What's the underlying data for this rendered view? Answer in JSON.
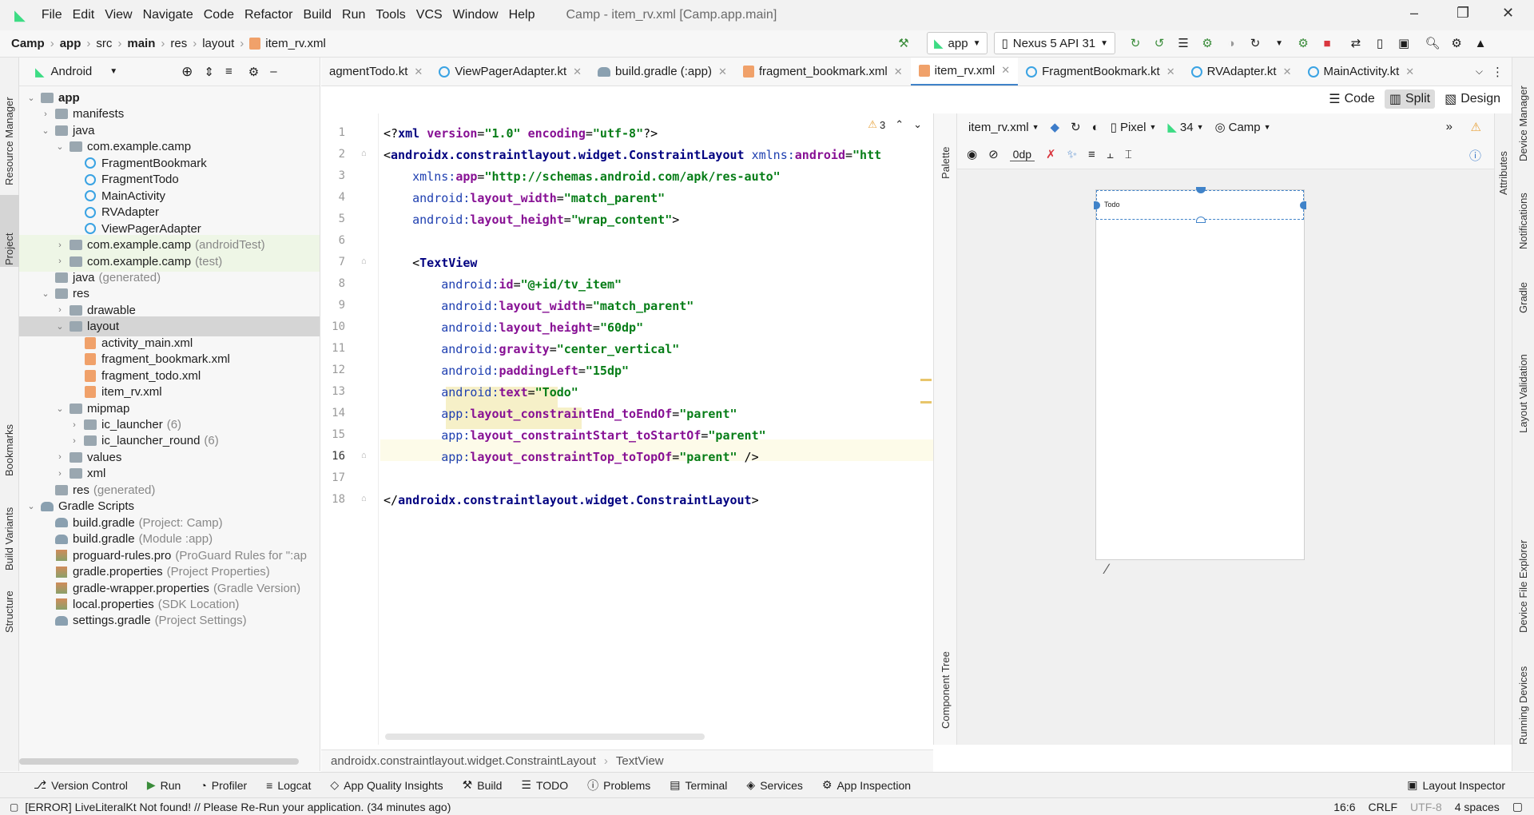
{
  "menu": {
    "items": [
      "File",
      "Edit",
      "View",
      "Navigate",
      "Code",
      "Refactor",
      "Build",
      "Run",
      "Tools",
      "VCS",
      "Window",
      "Help"
    ],
    "window_title": "Camp - item_rv.xml [Camp.app.main]"
  },
  "breadcrumb": [
    "Camp",
    "app",
    "src",
    "main",
    "res",
    "layout",
    "item_rv.xml"
  ],
  "run_config": {
    "module": "app",
    "device": "Nexus 5 API 31"
  },
  "project_panel": {
    "view_label": "Android",
    "tree": [
      {
        "label": "app",
        "extra": "",
        "level": 0,
        "arrow": "down",
        "icon": "folder",
        "bold": true
      },
      {
        "label": "manifests",
        "extra": "",
        "level": 1,
        "arrow": "right",
        "icon": "folder"
      },
      {
        "label": "java",
        "extra": "",
        "level": 1,
        "arrow": "down",
        "icon": "folder"
      },
      {
        "label": "com.example.camp",
        "extra": "",
        "level": 2,
        "arrow": "down",
        "icon": "folder"
      },
      {
        "label": "FragmentBookmark",
        "extra": "",
        "level": 3,
        "arrow": "",
        "icon": "kt"
      },
      {
        "label": "FragmentTodo",
        "extra": "",
        "level": 3,
        "arrow": "",
        "icon": "kt"
      },
      {
        "label": "MainActivity",
        "extra": "",
        "level": 3,
        "arrow": "",
        "icon": "kt"
      },
      {
        "label": "RVAdapter",
        "extra": "",
        "level": 3,
        "arrow": "",
        "icon": "kt"
      },
      {
        "label": "ViewPagerAdapter",
        "extra": "",
        "level": 3,
        "arrow": "",
        "icon": "kt"
      },
      {
        "label": "com.example.camp",
        "extra": "(androidTest)",
        "level": 2,
        "arrow": "right",
        "icon": "folder",
        "highlight": true
      },
      {
        "label": "com.example.camp",
        "extra": "(test)",
        "level": 2,
        "arrow": "right",
        "icon": "folder",
        "highlight": true
      },
      {
        "label": "java",
        "extra": "(generated)",
        "level": 1,
        "arrow": "",
        "icon": "folder"
      },
      {
        "label": "res",
        "extra": "",
        "level": 1,
        "arrow": "down",
        "icon": "folder"
      },
      {
        "label": "drawable",
        "extra": "",
        "level": 2,
        "arrow": "right",
        "icon": "folder"
      },
      {
        "label": "layout",
        "extra": "",
        "level": 2,
        "arrow": "down",
        "icon": "folder",
        "selected": true
      },
      {
        "label": "activity_main.xml",
        "extra": "",
        "level": 3,
        "arrow": "",
        "icon": "xml"
      },
      {
        "label": "fragment_bookmark.xml",
        "extra": "",
        "level": 3,
        "arrow": "",
        "icon": "xml"
      },
      {
        "label": "fragment_todo.xml",
        "extra": "",
        "level": 3,
        "arrow": "",
        "icon": "xml"
      },
      {
        "label": "item_rv.xml",
        "extra": "",
        "level": 3,
        "arrow": "",
        "icon": "xml"
      },
      {
        "label": "mipmap",
        "extra": "",
        "level": 2,
        "arrow": "down",
        "icon": "folder"
      },
      {
        "label": "ic_launcher",
        "extra": "(6)",
        "level": 3,
        "arrow": "right",
        "icon": "folder"
      },
      {
        "label": "ic_launcher_round",
        "extra": "(6)",
        "level": 3,
        "arrow": "right",
        "icon": "folder"
      },
      {
        "label": "values",
        "extra": "",
        "level": 2,
        "arrow": "right",
        "icon": "folder"
      },
      {
        "label": "xml",
        "extra": "",
        "level": 2,
        "arrow": "right",
        "icon": "folder"
      },
      {
        "label": "res",
        "extra": "(generated)",
        "level": 1,
        "arrow": "",
        "icon": "folder"
      },
      {
        "label": "Gradle Scripts",
        "extra": "",
        "level": 0,
        "arrow": "down",
        "icon": "gradle"
      },
      {
        "label": "build.gradle",
        "extra": "(Project: Camp)",
        "level": 1,
        "arrow": "",
        "icon": "gradle"
      },
      {
        "label": "build.gradle",
        "extra": "(Module :app)",
        "level": 1,
        "arrow": "",
        "icon": "gradle"
      },
      {
        "label": "proguard-rules.pro",
        "extra": "(ProGuard Rules for \":ap",
        "level": 1,
        "arrow": "",
        "icon": "prop"
      },
      {
        "label": "gradle.properties",
        "extra": "(Project Properties)",
        "level": 1,
        "arrow": "",
        "icon": "prop"
      },
      {
        "label": "gradle-wrapper.properties",
        "extra": "(Gradle Version)",
        "level": 1,
        "arrow": "",
        "icon": "prop"
      },
      {
        "label": "local.properties",
        "extra": "(SDK Location)",
        "level": 1,
        "arrow": "",
        "icon": "prop"
      },
      {
        "label": "settings.gradle",
        "extra": "(Project Settings)",
        "level": 1,
        "arrow": "",
        "icon": "gradle"
      }
    ]
  },
  "left_strip": [
    "Resource Manager",
    "Project",
    "Bookmarks",
    "Build Variants",
    "Structure"
  ],
  "tabs": [
    {
      "label": "agmentTodo.kt",
      "icon": "kt"
    },
    {
      "label": "ViewPagerAdapter.kt",
      "icon": "kt"
    },
    {
      "label": "build.gradle (:app)",
      "icon": "gradle"
    },
    {
      "label": "fragment_bookmark.xml",
      "icon": "xml"
    },
    {
      "label": "item_rv.xml",
      "icon": "xml",
      "active": true
    },
    {
      "label": "FragmentBookmark.kt",
      "icon": "kt"
    },
    {
      "label": "RVAdapter.kt",
      "icon": "kt"
    },
    {
      "label": "MainActivity.kt",
      "icon": "kt"
    }
  ],
  "view_modes": [
    "Code",
    "Split",
    "Design"
  ],
  "editor": {
    "warnings_count": "3",
    "lines": [
      [
        [
          "t-plain",
          "<?"
        ],
        [
          "t-tag",
          "xml "
        ],
        [
          "t-attr",
          "version"
        ],
        [
          "t-plain",
          "="
        ],
        [
          "t-val",
          "\"1.0\" "
        ],
        [
          "t-attr",
          "encoding"
        ],
        [
          "t-plain",
          "="
        ],
        [
          "t-val",
          "\"utf-8\""
        ],
        [
          "t-plain",
          "?>"
        ]
      ],
      [
        [
          "t-plain",
          "<"
        ],
        [
          "t-tag",
          "androidx.constraintlayout.widget.ConstraintLayout "
        ],
        [
          "t-ns",
          "xmlns:"
        ],
        [
          "t-attr",
          "android"
        ],
        [
          "t-plain",
          "="
        ],
        [
          "t-val",
          "\"htt"
        ]
      ],
      [
        [
          "t-plain",
          "    "
        ],
        [
          "t-ns",
          "xmlns:"
        ],
        [
          "t-attr",
          "app"
        ],
        [
          "t-plain",
          "="
        ],
        [
          "t-val",
          "\"http://schemas.android.com/apk/res-auto\""
        ]
      ],
      [
        [
          "t-plain",
          "    "
        ],
        [
          "t-ns",
          "android:"
        ],
        [
          "t-attr",
          "layout_width"
        ],
        [
          "t-plain",
          "="
        ],
        [
          "t-val",
          "\"match_parent\""
        ]
      ],
      [
        [
          "t-plain",
          "    "
        ],
        [
          "t-ns",
          "android:"
        ],
        [
          "t-attr",
          "layout_height"
        ],
        [
          "t-plain",
          "="
        ],
        [
          "t-val",
          "\"wrap_content\""
        ],
        [
          "t-plain",
          ">"
        ]
      ],
      [],
      [
        [
          "t-plain",
          "    <"
        ],
        [
          "t-tag",
          "TextView"
        ]
      ],
      [
        [
          "t-plain",
          "        "
        ],
        [
          "t-ns",
          "android:"
        ],
        [
          "t-attr",
          "id"
        ],
        [
          "t-plain",
          "="
        ],
        [
          "t-val",
          "\"@+id/tv_item\""
        ]
      ],
      [
        [
          "t-plain",
          "        "
        ],
        [
          "t-ns",
          "android:"
        ],
        [
          "t-attr",
          "layout_width"
        ],
        [
          "t-plain",
          "="
        ],
        [
          "t-val",
          "\"match_parent\""
        ]
      ],
      [
        [
          "t-plain",
          "        "
        ],
        [
          "t-ns",
          "android:"
        ],
        [
          "t-attr",
          "layout_height"
        ],
        [
          "t-plain",
          "="
        ],
        [
          "t-val",
          "\"60dp\""
        ]
      ],
      [
        [
          "t-plain",
          "        "
        ],
        [
          "t-ns",
          "android:"
        ],
        [
          "t-attr",
          "gravity"
        ],
        [
          "t-plain",
          "="
        ],
        [
          "t-val",
          "\"center_vertical\""
        ]
      ],
      [
        [
          "t-plain",
          "        "
        ],
        [
          "t-ns",
          "android:"
        ],
        [
          "t-attr",
          "paddingLeft"
        ],
        [
          "t-plain",
          "="
        ],
        [
          "t-val",
          "\"15dp\""
        ]
      ],
      [
        [
          "t-plain",
          "        "
        ],
        [
          "t-ns",
          "android:"
        ],
        [
          "t-attr",
          "text"
        ],
        [
          "t-plain",
          "="
        ],
        [
          "t-val",
          "\"Todo\""
        ]
      ],
      [
        [
          "t-plain",
          "        "
        ],
        [
          "t-ns",
          "app:"
        ],
        [
          "t-attr",
          "layout_constraintEnd_toEndOf"
        ],
        [
          "t-plain",
          "="
        ],
        [
          "t-val",
          "\"parent\""
        ]
      ],
      [
        [
          "t-plain",
          "        "
        ],
        [
          "t-ns",
          "app:"
        ],
        [
          "t-attr",
          "layout_constraintStart_toStartOf"
        ],
        [
          "t-plain",
          "="
        ],
        [
          "t-val",
          "\"parent\""
        ]
      ],
      [
        [
          "t-plain",
          "        "
        ],
        [
          "t-ns",
          "app:"
        ],
        [
          "t-attr",
          "layout_constraintTop_toTopOf"
        ],
        [
          "t-plain",
          "="
        ],
        [
          "t-val",
          "\"parent\""
        ],
        [
          "t-plain",
          " />"
        ]
      ],
      [],
      [
        [
          "t-plain",
          "</"
        ],
        [
          "t-tag",
          "androidx.constraintlayout.widget.ConstraintLayout"
        ],
        [
          "t-plain",
          ">"
        ]
      ]
    ],
    "line_numbers": [
      "1",
      "2",
      "3",
      "4",
      "5",
      "6",
      "7",
      "8",
      "9",
      "10",
      "11",
      "12",
      "13",
      "14",
      "15",
      "16",
      "17",
      "18"
    ],
    "current_line": 16
  },
  "palette_strip": {
    "top": "Palette",
    "bottom": "Component Tree"
  },
  "design": {
    "file": "item_rv.xml",
    "device": "Pixel",
    "api": "34",
    "theme": "Camp",
    "margin": "0dp",
    "preview_text": "Todo"
  },
  "right_strip": [
    "Attributes"
  ],
  "far_right": [
    "Device Manager",
    "Notifications",
    "Gradle",
    "Layout Validation",
    "Device File Explorer",
    "Running Devices"
  ],
  "editor_breadcrumb": [
    "androidx.constraintlayout.widget.ConstraintLayout",
    "TextView"
  ],
  "tool_windows": [
    "Version Control",
    "Run",
    "Profiler",
    "Logcat",
    "App Quality Insights",
    "Build",
    "TODO",
    "Problems",
    "Terminal",
    "Services",
    "App Inspection"
  ],
  "layout_inspector": "Layout Inspector",
  "status": {
    "message": "[ERROR] LiveLiteralKt Not found! // Please Re-Run your application. (34 minutes ago)",
    "position": "16:6",
    "line_sep": "CRLF",
    "encoding": "UTF-8",
    "indent": "4 spaces"
  },
  "colors": {
    "accent": "#4083c9",
    "selection": "#d5d5d5",
    "highlight_row": "#eef6e6",
    "current_line": "#fdfbe9"
  }
}
